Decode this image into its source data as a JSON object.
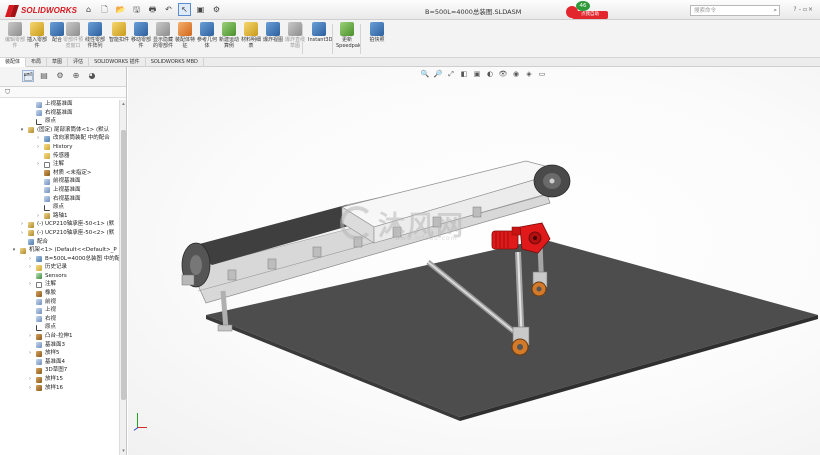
{
  "app": {
    "logo_text": "SOLIDWORKS",
    "document_title": "B=500L=4000总装图.SLDASM",
    "badge": {
      "number": "46",
      "ribbon_text": "点我自助"
    },
    "search_placeholder": "搜索命令"
  },
  "quick_access": [
    "⌂",
    "🗋",
    "📂",
    "🖫",
    "🖶",
    "↶",
    "↖",
    "▣",
    "⚙"
  ],
  "ribbon": {
    "buttons": [
      {
        "label": "编辑零部件",
        "icon": "edit-component-icon",
        "dim": true
      },
      {
        "label": "插入零部件",
        "icon": "insert-component-icon",
        "dim": false
      },
      {
        "label": "配合",
        "icon": "mate-icon",
        "dim": false
      },
      {
        "label": "零部件预览窗口",
        "icon": "component-preview-icon",
        "dim": true
      },
      {
        "label": "线性零部件阵列",
        "icon": "linear-pattern-icon",
        "dim": false
      },
      {
        "label": "智能扣件",
        "icon": "smart-fasteners-icon",
        "dim": false
      },
      {
        "label": "移动零部件",
        "icon": "move-component-icon",
        "dim": false
      },
      {
        "label": "显示隐藏的零部件",
        "icon": "show-hidden-icon",
        "dim": false
      },
      {
        "label": "装配体特征",
        "icon": "assembly-features-icon",
        "dim": false
      },
      {
        "label": "参考几何体",
        "icon": "reference-geometry-icon",
        "dim": false
      },
      {
        "label": "新建运动算例",
        "icon": "motion-study-icon",
        "dim": false
      },
      {
        "label": "材料明细表",
        "icon": "bom-icon",
        "dim": false
      },
      {
        "label": "爆炸视图",
        "icon": "exploded-view-icon",
        "dim": false
      },
      {
        "label": "爆炸直线草图",
        "icon": "explode-line-sketch-icon",
        "dim": true
      },
      {
        "label": "Instant3D",
        "icon": "instant3d-icon",
        "dim": false
      },
      {
        "label": "更新Speedpak",
        "icon": "speedpak-icon",
        "dim": false
      },
      {
        "label": "拍快照",
        "icon": "snapshot-icon",
        "dim": false
      }
    ]
  },
  "command_tabs": [
    "装配体",
    "布局",
    "草图",
    "评估",
    "SOLIDWORKS 插件",
    "SOLIDWORKS MBD"
  ],
  "fm_tabs": [
    "feature-manager",
    "property-manager",
    "configuration-manager",
    "dimxpert-manager",
    "display-manager"
  ],
  "tree": [
    {
      "label": "上视基准面",
      "indent": 36,
      "icon": "plane",
      "twisty": ""
    },
    {
      "label": "右视基准面",
      "indent": 36,
      "icon": "plane",
      "twisty": ""
    },
    {
      "label": "原点",
      "indent": 36,
      "icon": "origin",
      "twisty": ""
    },
    {
      "label": "(固定) 尾部滚筒体<1> (默认",
      "indent": 28,
      "icon": "asm",
      "twisty": "▾"
    },
    {
      "label": "改向滚筒装配 中的配合",
      "indent": 44,
      "icon": "mate",
      "twisty": "›"
    },
    {
      "label": "History",
      "indent": 44,
      "icon": "fold",
      "twisty": "›"
    },
    {
      "label": "传感器",
      "indent": 44,
      "icon": "fold",
      "twisty": ""
    },
    {
      "label": "注解",
      "indent": 44,
      "icon": "note",
      "twisty": "›"
    },
    {
      "label": "材质 <未指定>",
      "indent": 44,
      "icon": "feat",
      "twisty": ""
    },
    {
      "label": "前视基准面",
      "indent": 44,
      "icon": "plane",
      "twisty": ""
    },
    {
      "label": "上视基准面",
      "indent": 44,
      "icon": "plane",
      "twisty": ""
    },
    {
      "label": "右视基准面",
      "indent": 44,
      "icon": "plane",
      "twisty": ""
    },
    {
      "label": "原点",
      "indent": 44,
      "icon": "origin",
      "twisty": ""
    },
    {
      "label": "路轴1",
      "indent": 44,
      "icon": "asm",
      "twisty": "›"
    },
    {
      "label": "(-) UCP210轴承座-50<1> (默",
      "indent": 28,
      "icon": "asm",
      "twisty": "›"
    },
    {
      "label": "(-) UCP210轴承座-50<2> (默",
      "indent": 28,
      "icon": "asm",
      "twisty": "›"
    },
    {
      "label": "配合",
      "indent": 28,
      "icon": "mate",
      "twisty": ""
    },
    {
      "label": "机架<1> (Default<<Default>_P",
      "indent": 20,
      "icon": "asm",
      "twisty": "▾"
    },
    {
      "label": "B=500L=4000总装图 中的配",
      "indent": 36,
      "icon": "mate",
      "twisty": "›"
    },
    {
      "label": "历史记录",
      "indent": 36,
      "icon": "fold",
      "twisty": "›"
    },
    {
      "label": "Sensors",
      "indent": 36,
      "icon": "sens",
      "twisty": ""
    },
    {
      "label": "注解",
      "indent": 36,
      "icon": "note",
      "twisty": "›"
    },
    {
      "label": "橡胶",
      "indent": 36,
      "icon": "feat",
      "twisty": ""
    },
    {
      "label": "前视",
      "indent": 36,
      "icon": "plane",
      "twisty": ""
    },
    {
      "label": "上视",
      "indent": 36,
      "icon": "plane",
      "twisty": ""
    },
    {
      "label": "右视",
      "indent": 36,
      "icon": "plane",
      "twisty": ""
    },
    {
      "label": "原点",
      "indent": 36,
      "icon": "origin",
      "twisty": ""
    },
    {
      "label": "凸台-拉伸1",
      "indent": 36,
      "icon": "feat",
      "twisty": "›"
    },
    {
      "label": "基准面3",
      "indent": 36,
      "icon": "plane",
      "twisty": ""
    },
    {
      "label": "放样5",
      "indent": 36,
      "icon": "feat",
      "twisty": "›"
    },
    {
      "label": "基准面4",
      "indent": 36,
      "icon": "plane",
      "twisty": ""
    },
    {
      "label": "3D草图7",
      "indent": 36,
      "icon": "feat",
      "twisty": ""
    },
    {
      "label": "放样15",
      "indent": 36,
      "icon": "feat",
      "twisty": "›"
    },
    {
      "label": "放样16",
      "indent": 36,
      "icon": "feat",
      "twisty": "›"
    }
  ],
  "viewport": {
    "heads_up_icons": [
      "🔍",
      "🔎",
      "⤢",
      "◧",
      "▣",
      "◐",
      "👁",
      "◉",
      "◈",
      "▭"
    ],
    "watermark_text": "沐风网",
    "watermark_sub": "www.mfcad.com"
  },
  "colors": {
    "accent": "#d71920",
    "motor": "#e01a1a",
    "base_plate": "#505050",
    "panel_bg": "#f3f3f3"
  }
}
